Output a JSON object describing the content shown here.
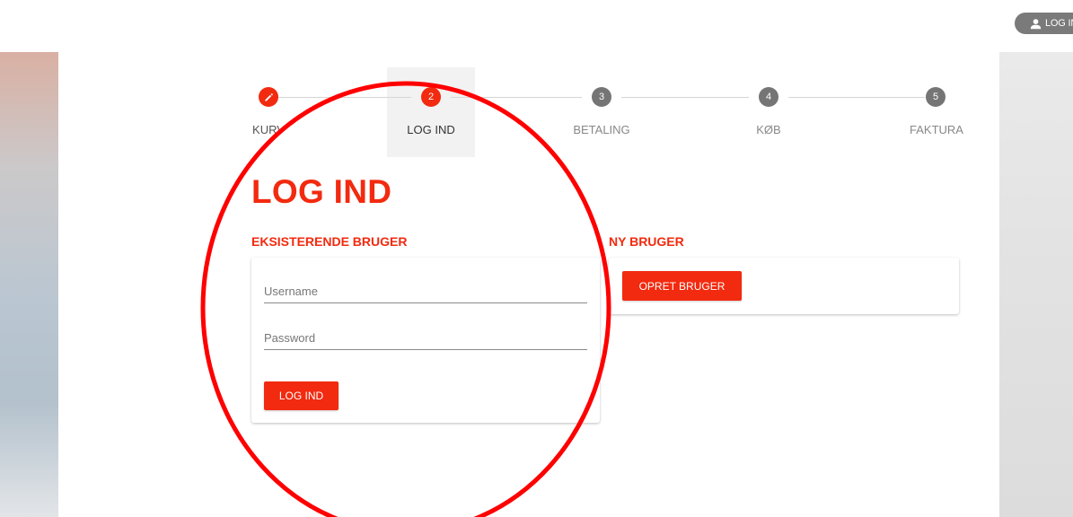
{
  "header": {
    "login_label": "LOG IN"
  },
  "stepper": {
    "steps": [
      {
        "number": "✎",
        "label": "KURV",
        "state": "done"
      },
      {
        "number": "2",
        "label": "LOG IND",
        "state": "active"
      },
      {
        "number": "3",
        "label": "BETALING",
        "state": "pending"
      },
      {
        "number": "4",
        "label": "KØB",
        "state": "pending"
      },
      {
        "number": "5",
        "label": "FAKTURA",
        "state": "pending"
      }
    ]
  },
  "page": {
    "title": "LOG IND"
  },
  "existing_user": {
    "title": "EKSISTERENDE BRUGER",
    "username_placeholder": "Username",
    "password_placeholder": "Password",
    "login_button": "LOG IND"
  },
  "new_user": {
    "title": "NY BRUGER",
    "create_button": "OPRET BRUGER"
  },
  "colors": {
    "accent": "#f22a0f",
    "pending_step": "#757575",
    "annotation_circle": "#ff0000"
  }
}
